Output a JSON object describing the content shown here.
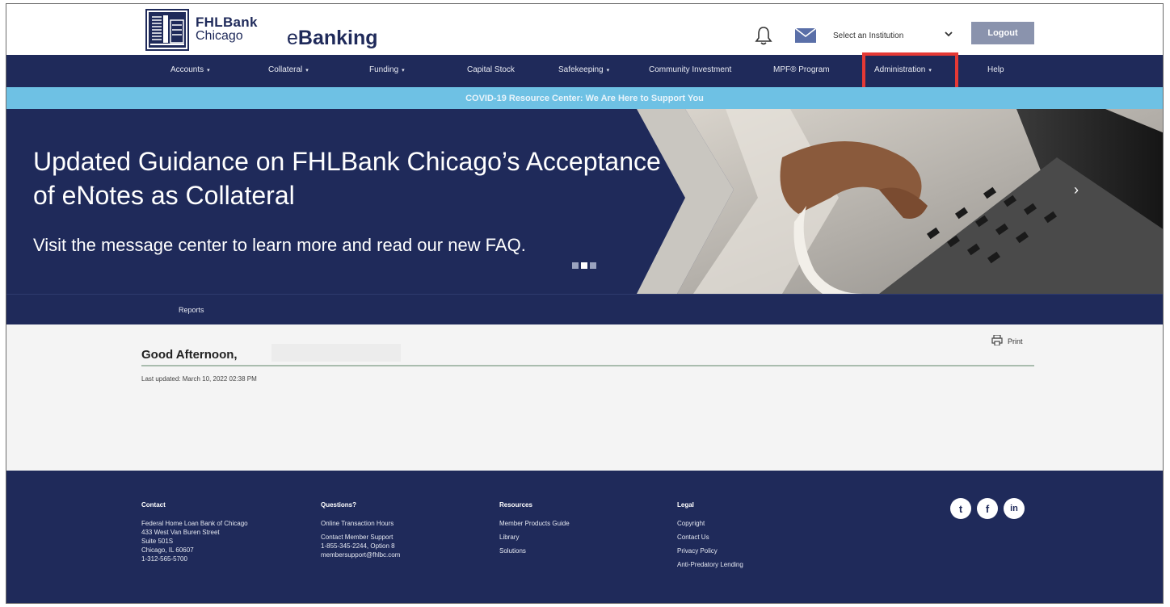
{
  "header": {
    "brand_top": "FHLBank",
    "brand_bottom": "Chicago",
    "app_prefix": "e",
    "app_name": "Banking",
    "institution_placeholder": "Select an Institution",
    "logout_label": "Logout"
  },
  "nav": {
    "items": [
      {
        "label": "Accounts",
        "caret": "▾"
      },
      {
        "label": "Collateral",
        "caret": "▾"
      },
      {
        "label": "Funding",
        "caret": "▾"
      },
      {
        "label": "Capital Stock"
      },
      {
        "label": "Safekeeping",
        "caret": "▾"
      },
      {
        "label": "Community Investment"
      },
      {
        "label": "MPF® Program"
      },
      {
        "label": "Administration",
        "caret": "▾"
      },
      {
        "label": "Help"
      }
    ],
    "highlighted": "Administration"
  },
  "covid_banner": "COVID-19 Resource Center: We Are Here to Support You",
  "hero": {
    "title": "Updated Guidance on FHLBank Chicago’s Acceptance of eNotes as Collateral",
    "subtitle": "Visit the message center to learn more and read our new FAQ.",
    "slides": 3,
    "active_slide": 2,
    "next_glyph": "›",
    "prev_glyph": "‹"
  },
  "subnav": {
    "reports_label": "Reports"
  },
  "content": {
    "greeting": "Good Afternoon,",
    "last_updated": "Last updated: March 10, 2022 02:38 PM",
    "print_label": "Print"
  },
  "footer": {
    "contact": {
      "heading": "Contact",
      "lines": [
        "Federal Home Loan Bank of Chicago",
        "433 West Van Buren Street",
        "Suite 501S",
        "Chicago, IL 60607",
        "1-312-565-5700"
      ]
    },
    "questions": {
      "heading": "Questions?",
      "hours": "Online Transaction Hours",
      "support_lines": [
        "Contact Member Support",
        "1-855-345-2244, Option 8",
        "membersupport@fhlbc.com"
      ]
    },
    "resources": {
      "heading": "Resources",
      "links": [
        "Member Products Guide",
        "Library",
        "Solutions"
      ]
    },
    "legal": {
      "heading": "Legal",
      "links": [
        "Copyright",
        "Contact Us",
        "Privacy Policy",
        "Anti-Predatory Lending"
      ]
    },
    "social": {
      "twitter": "t",
      "facebook": "f",
      "linkedin": "in"
    }
  },
  "colors": {
    "navy": "#1f2a5a",
    "banner_blue": "#6ec1e4",
    "highlight_red": "#e53935",
    "logout_gray": "#8a93ad"
  },
  "icons": [
    "logo-icon",
    "bell-icon",
    "mail-icon",
    "chevron-down-icon",
    "printer-icon",
    "twitter-icon",
    "facebook-icon",
    "linkedin-icon"
  ]
}
